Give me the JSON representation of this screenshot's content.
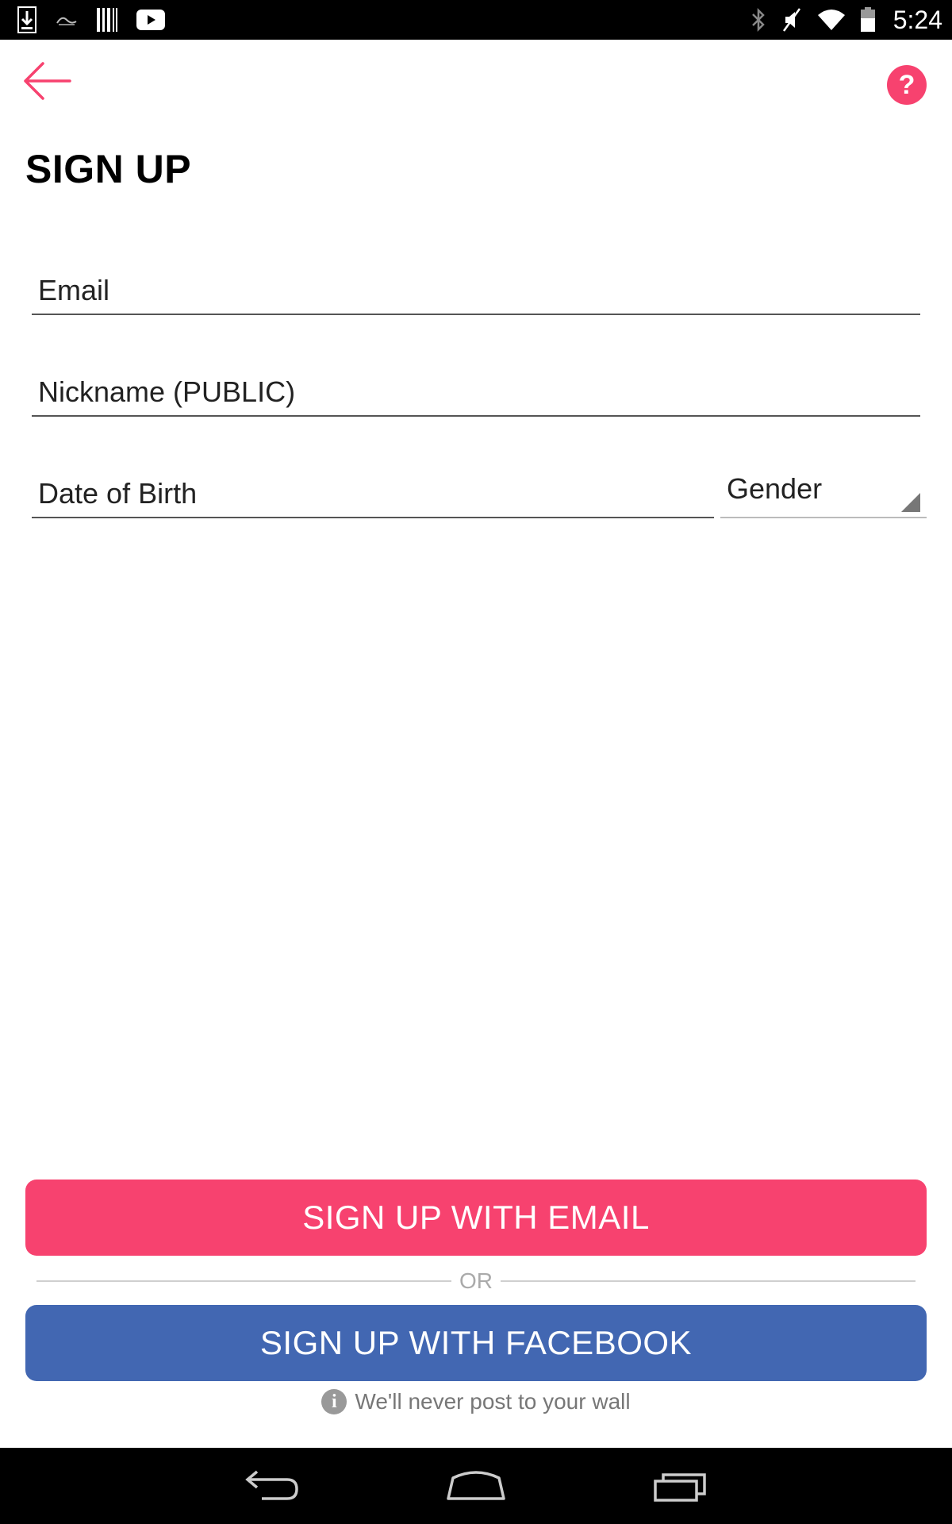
{
  "status_bar": {
    "time": "5:24",
    "left_icons": [
      "download-icon",
      "notification-icon",
      "barcode-icon",
      "youtube-icon"
    ],
    "right_icons": [
      "bluetooth-icon",
      "mute-icon",
      "wifi-icon",
      "battery-icon"
    ]
  },
  "header": {
    "back_icon": "arrow-left-icon",
    "help_label": "?",
    "title": "SIGN UP"
  },
  "form": {
    "email_placeholder": "Email",
    "nickname_placeholder": "Nickname (PUBLIC)",
    "dob_placeholder": "Date of Birth",
    "gender_selected": "Gender"
  },
  "actions": {
    "email_button": "SIGN UP WITH EMAIL",
    "or_text": "OR",
    "facebook_button": "SIGN UP WITH FACEBOOK",
    "note_icon": "i",
    "note_text": "We'll never post to your wall"
  },
  "nav_bar": {
    "buttons": [
      "back-icon",
      "home-icon",
      "recent-apps-icon"
    ]
  },
  "colors": {
    "accent": "#f7426f",
    "facebook": "#4267b2"
  }
}
